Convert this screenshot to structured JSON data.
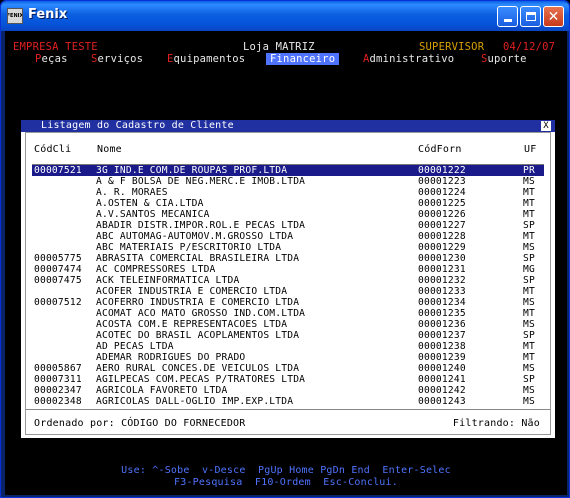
{
  "window": {
    "title": "Fenix",
    "icon_label": "FENIX"
  },
  "header": {
    "company": "EMPRESA TESTE",
    "loja": "Loja MATRIZ",
    "role": "SUPERVISOR",
    "date": "04/12/07"
  },
  "menu": [
    {
      "hot": "P",
      "rest": "eças"
    },
    {
      "hot": "S",
      "rest": "erviços"
    },
    {
      "hot": "E",
      "rest": "quipamentos"
    },
    {
      "hot": "F",
      "rest": "inanceiro",
      "active": true
    },
    {
      "hot": "A",
      "rest": "dministrativo"
    },
    {
      "hot": "S",
      "rest": "uporte"
    }
  ],
  "dialog": {
    "title": "Listagem do Cadastro de Cliente",
    "close": "X",
    "columns": {
      "codcli": "CódCli",
      "nome": "Nome",
      "codforn": "CódForn",
      "uf": "UF"
    },
    "rows": [
      {
        "codcli": "00007521",
        "nome": "3G IND.E COM.DE ROUPAS PROF.LTDA",
        "codforn": "00001222",
        "uf": "PR"
      },
      {
        "codcli": "",
        "nome": "A & F BOLSA DE NEG.MERC.E IMOB.LTDA",
        "codforn": "00001223",
        "uf": "MS"
      },
      {
        "codcli": "",
        "nome": "A. R. MORAES",
        "codforn": "00001224",
        "uf": "MT"
      },
      {
        "codcli": "",
        "nome": "A.OSTEN & CIA.LTDA",
        "codforn": "00001225",
        "uf": "MT"
      },
      {
        "codcli": "",
        "nome": "A.V.SANTOS MECANICA",
        "codforn": "00001226",
        "uf": "MT"
      },
      {
        "codcli": "",
        "nome": "ABADIR DISTR.IMPOR.ROL.E PECAS LTDA",
        "codforn": "00001227",
        "uf": "SP"
      },
      {
        "codcli": "",
        "nome": "ABC AUTOMAG-AUTOMOV.M.GROSSO LTDA",
        "codforn": "00001228",
        "uf": "MT"
      },
      {
        "codcli": "",
        "nome": "ABC MATERIAIS P/ESCRITORIO LTDA",
        "codforn": "00001229",
        "uf": "MS"
      },
      {
        "codcli": "00005775",
        "nome": "ABRASITA COMERCIAL BRASILEIRA LTDA",
        "codforn": "00001230",
        "uf": "SP"
      },
      {
        "codcli": "00007474",
        "nome": "AC COMPRESSORES LTDA",
        "codforn": "00001231",
        "uf": "MG"
      },
      {
        "codcli": "00007475",
        "nome": "ACK TELEINFORMATICA LTDA",
        "codforn": "00001232",
        "uf": "SP"
      },
      {
        "codcli": "",
        "nome": "ACOFER INDUSTRIA E COMERCIO LTDA",
        "codforn": "00001233",
        "uf": "MT"
      },
      {
        "codcli": "00007512",
        "nome": "ACOFERRO INDUSTRIA E COMERCIO LTDA",
        "codforn": "00001234",
        "uf": "MS"
      },
      {
        "codcli": "",
        "nome": "ACOMAT ACO MATO GROSSO IND.COM.LTDA",
        "codforn": "00001235",
        "uf": "MT"
      },
      {
        "codcli": "",
        "nome": "ACOSTA COM.E REPRESENTACOES LTDA",
        "codforn": "00001236",
        "uf": "MS"
      },
      {
        "codcli": "",
        "nome": "ACOTEC DO BRASIL ACOPLAMENTOS LTDA",
        "codforn": "00001237",
        "uf": "SP"
      },
      {
        "codcli": "",
        "nome": "AD PECAS LTDA",
        "codforn": "00001238",
        "uf": "MT"
      },
      {
        "codcli": "",
        "nome": "ADEMAR RODRIGUES DO PRADO",
        "codforn": "00001239",
        "uf": "MT"
      },
      {
        "codcli": "00005867",
        "nome": "AERO RURAL CONCES.DE VEICULOS LTDA",
        "codforn": "00001240",
        "uf": "MS"
      },
      {
        "codcli": "00007311",
        "nome": "AGILPECAS COM.PECAS P/TRATORES LTDA",
        "codforn": "00001241",
        "uf": "SP"
      },
      {
        "codcli": "00002347",
        "nome": "AGRICOLA FAVORETO LTDA",
        "codforn": "00001242",
        "uf": "MS"
      },
      {
        "codcli": "00002348",
        "nome": "AGRICOLAS DALL-OGLIO IMP.EXP.LTDA",
        "codforn": "00001243",
        "uf": "MS"
      }
    ],
    "footer": {
      "ordenado": "Ordenado por: CÓDIGO DO FORNECEDOR",
      "filtrando": "Filtrando: Não"
    }
  },
  "help": {
    "line1": "Use: ^-Sobe  v-Desce  PgUp Home PgDn End  Enter-Selec",
    "line2": "F3-Pesquisa  F10-Ordem  Esc-Conclui."
  }
}
